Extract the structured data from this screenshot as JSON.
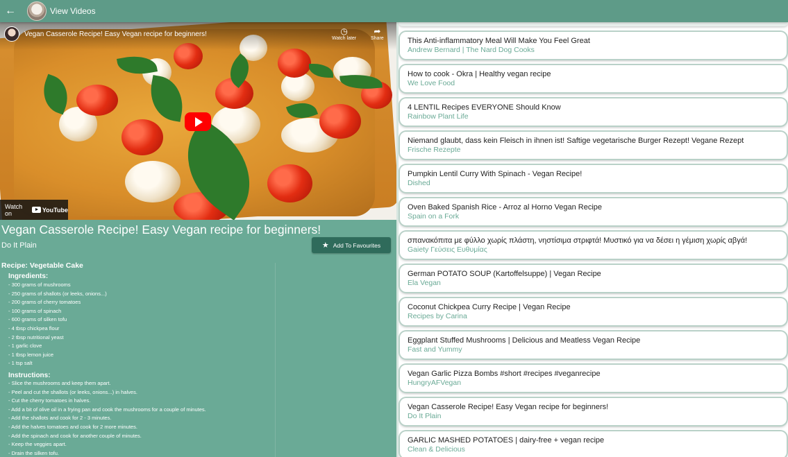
{
  "appbar": {
    "title": "View Videos"
  },
  "player": {
    "title": "Vegan Casserole Recipe! Easy Vegan recipe for beginners!",
    "watch_later": "Watch later",
    "share": "Share",
    "watch_on": "Watch on",
    "youtube": "YouTube"
  },
  "video": {
    "title": "Vegan Casserole Recipe! Easy Vegan recipe for beginners!",
    "channel": "Do It Plain",
    "fav_label": "Add To Favourites"
  },
  "description": {
    "recipe_title": "Recipe: Vegetable Cake",
    "ingredients_heading": "Ingredients:",
    "ingredients": [
      "- 300 grams of mushrooms",
      "- 250 grams of shallots (or leeks, onions...)",
      "- 200 grams of cherry tomatoes",
      "- 100 grams of spinach",
      "- 600 grams of silken tofu",
      "- 4 tbsp chickpea flour",
      "- 2 tbsp nutritional yeast",
      "- 1 garlic clove",
      "- 1 tbsp lemon juice",
      "- 1 tsp salt"
    ],
    "instructions_heading": "Instructions:",
    "instructions": [
      "- Slice the mushrooms and keep them apart.",
      "- Peel and cut the shallots (or leeks, onions...) in halves.",
      "- Cut the cherry tomatoes in halves.",
      "- Add a bit of olive oil in a frying pan and cook the mushrooms for a couple of minutes.",
      "- Add the shallots and cook for 2 - 3 minutes.",
      "- Add the halves tomatoes and cook for 2 more minutes.",
      "- Add the spinach and cook for another couple of minutes.",
      "- Keep the veggies apart.",
      "- Drain the silken tofu."
    ]
  },
  "videos": [
    {
      "title": "This Anti-inflammatory Meal Will Make You Feel Great",
      "channel": "Andrew Bernard | The Nard Dog Cooks"
    },
    {
      "title": "How to cook - Okra | Healthy vegan recipe",
      "channel": "We Love Food"
    },
    {
      "title": "4 LENTIL Recipes EVERYONE Should Know",
      "channel": "Rainbow Plant Life"
    },
    {
      "title": "Niemand glaubt, dass kein Fleisch in ihnen ist! Saftige vegetarische Burger Rezept! Vegane Rezept",
      "channel": "Frische Rezepte"
    },
    {
      "title": "Pumpkin Lentil Curry With Spinach - Vegan Recipe!",
      "channel": "Dished"
    },
    {
      "title": "Oven Baked Spanish Rice - Arroz al Horno Vegan Recipe",
      "channel": "Spain on a Fork"
    },
    {
      "title": "σπανακόπιτα με φύλλο χωρίς πλάστη, νηστίσιμα στριφτά! Μυστικό για να δέσει η γέμιση χωρίς αβγά!",
      "channel": "Gaiety Γεύσεις Ευθυμίας"
    },
    {
      "title": "German POTATO SOUP (Kartoffelsuppe) | Vegan Recipe",
      "channel": "Ela Vegan"
    },
    {
      "title": "Coconut Chickpea Curry Recipe | Vegan Recipe",
      "channel": "Recipes by Carina"
    },
    {
      "title": "Eggplant Stuffed Mushrooms | Delicious and Meatless Vegan Recipe",
      "channel": "Fast and Yummy"
    },
    {
      "title": "Vegan Garlic Pizza Bombs #short #recipes #veganrecipe",
      "channel": "HungryAFVegan"
    },
    {
      "title": "Vegan Casserole Recipe! Easy Vegan recipe for beginners!",
      "channel": "Do It Plain"
    },
    {
      "title": "GARLIC MASHED POTATOES | dairy-free + vegan recipe",
      "channel": "Clean & Delicious"
    }
  ],
  "colors": {
    "appbar": "#5e9b88",
    "panel": "#6aaa96",
    "button": "#2f6b5b",
    "accent": "#6aaa96"
  },
  "icons": {
    "back": "arrow-left-icon",
    "watch_later": "clock-icon",
    "share": "share-icon",
    "favourite": "star-icon",
    "play": "play-icon"
  }
}
